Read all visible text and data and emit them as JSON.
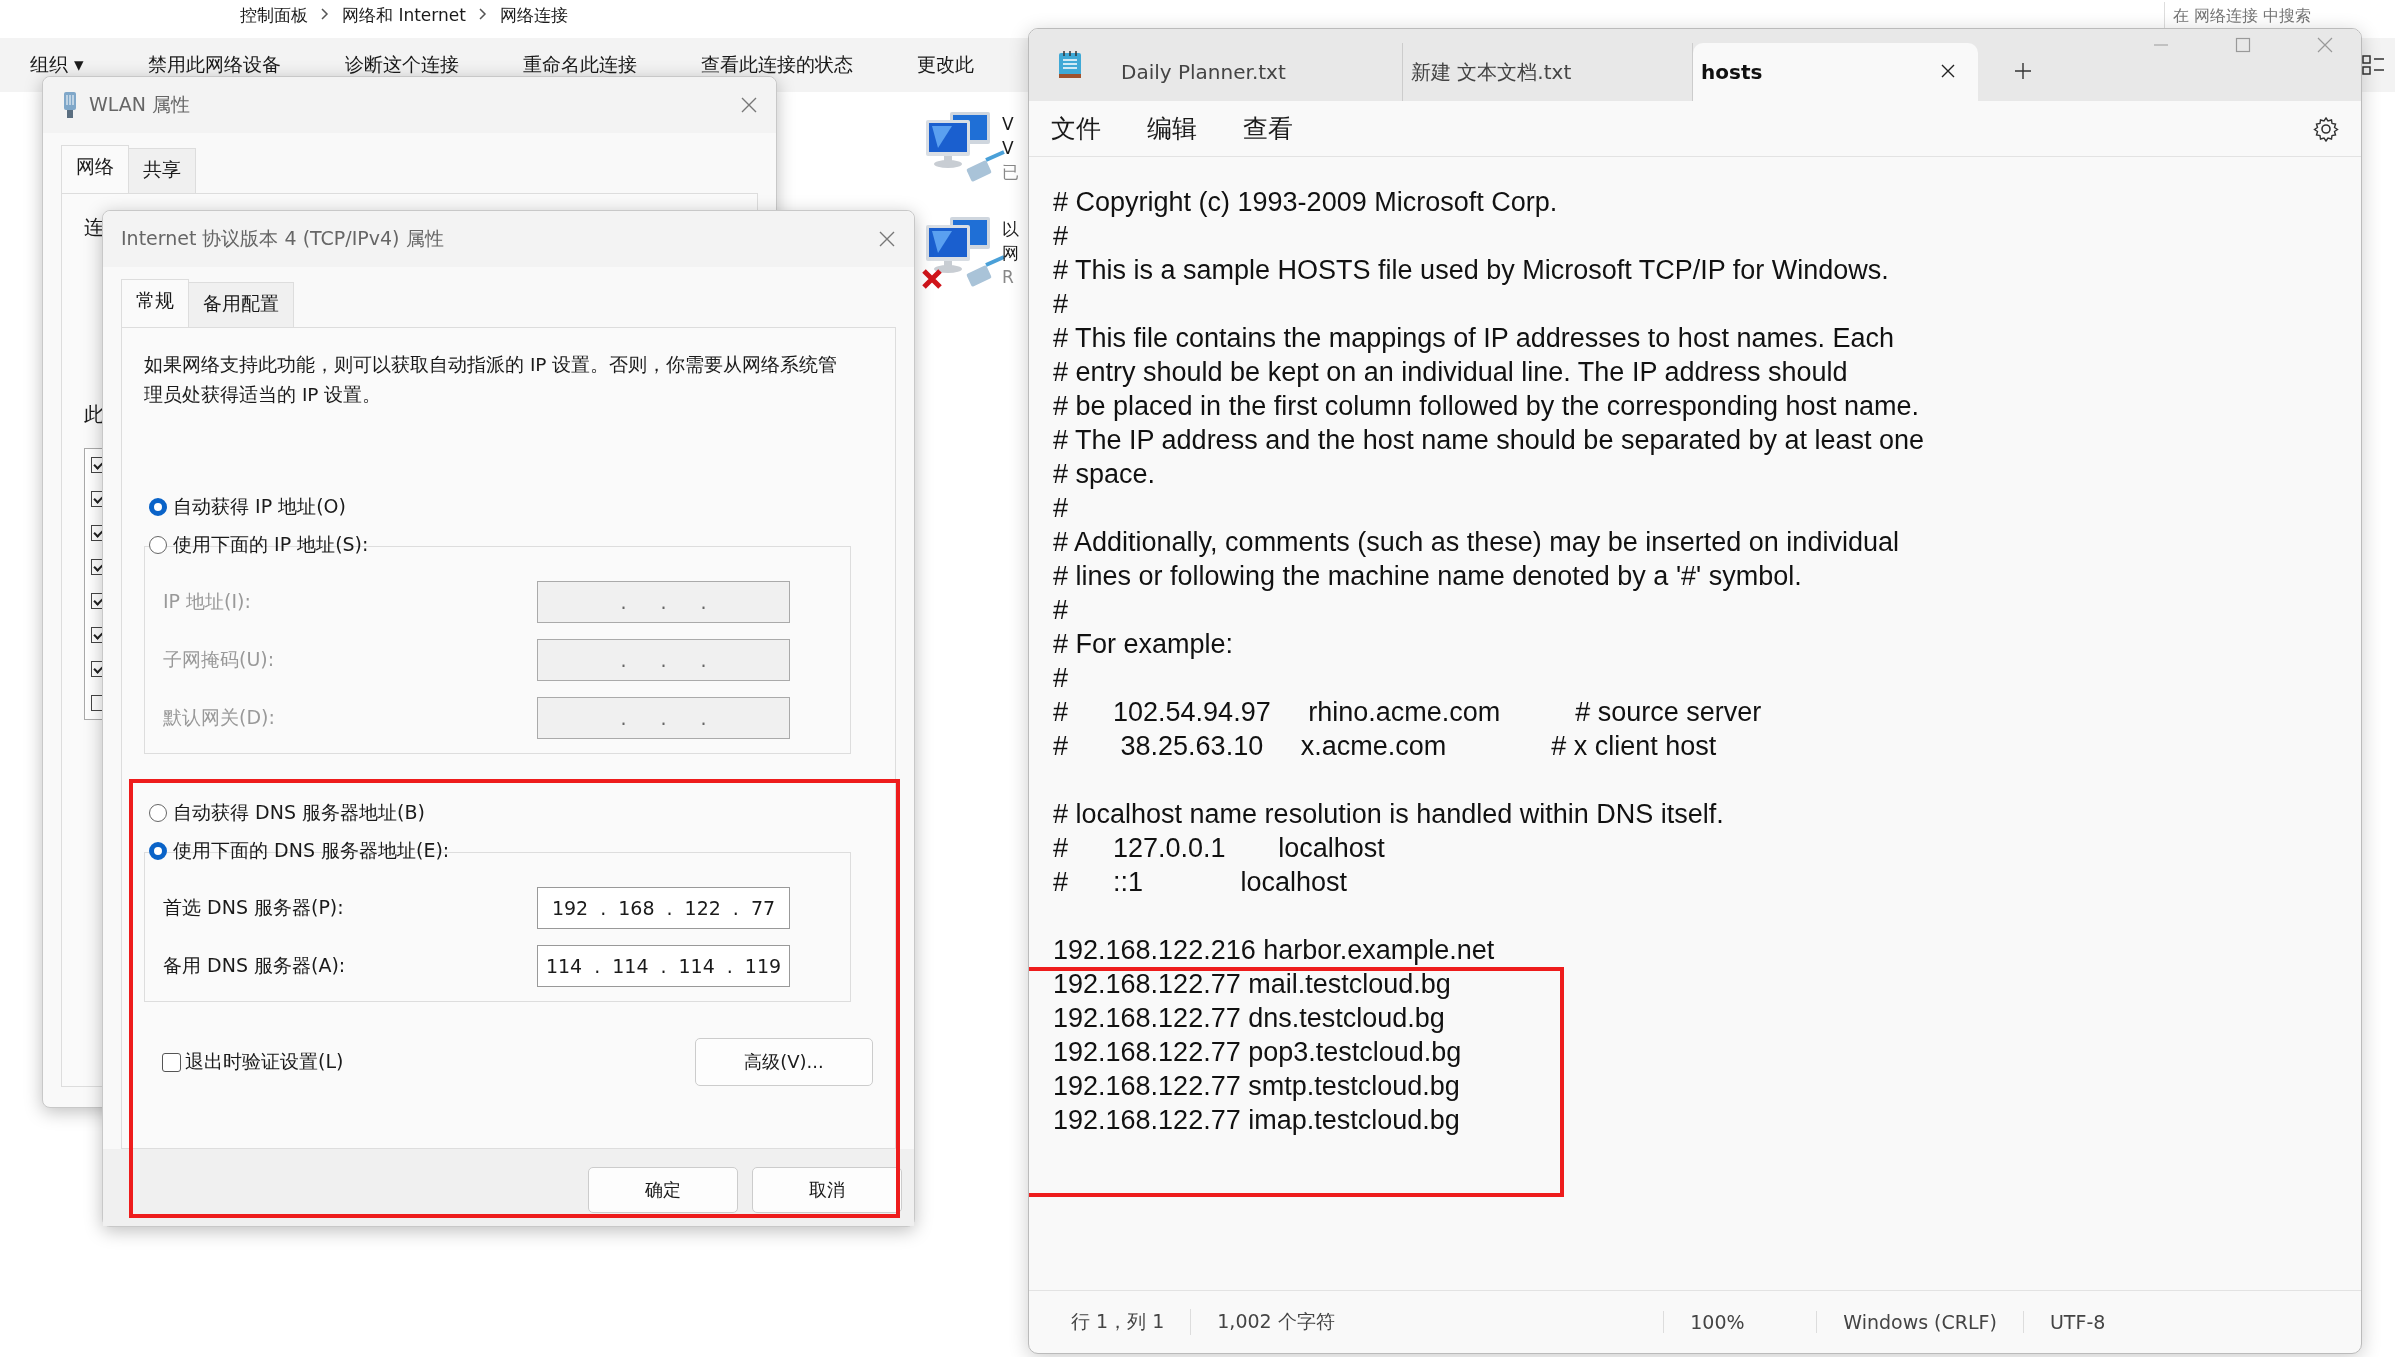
{
  "explorer": {
    "breadcrumb": [
      "控制面板",
      "网络和 Internet",
      "网络连接"
    ],
    "search": {
      "placeholder": "在 网络连接 中搜索"
    },
    "toolbar": [
      "组织 ▾",
      "禁用此网络设备",
      "诊断这个连接",
      "重命名此连接",
      "查看此连接的状态",
      "更改此"
    ],
    "connections": [
      {
        "lines": [
          "V",
          "V",
          "已"
        ],
        "disabled": false
      },
      {
        "lines": [
          "以",
          "网",
          "R"
        ],
        "disabled": true
      }
    ]
  },
  "wlan_dialog": {
    "title": "WLAN 属性",
    "tabs": [
      {
        "label": "网络",
        "selected": true
      },
      {
        "label": "共享",
        "selected": false
      }
    ],
    "fragments": [
      "连",
      "此"
    ],
    "items": [
      {
        "checked": true
      },
      {
        "checked": true
      },
      {
        "checked": true
      },
      {
        "checked": true
      },
      {
        "checked": true
      },
      {
        "checked": true
      },
      {
        "checked": true
      },
      {
        "checked": false
      }
    ]
  },
  "ipv4_dialog": {
    "title": "Internet 协议版本 4 (TCP/IPv4) 属性",
    "tabs": [
      {
        "label": "常规",
        "selected": true
      },
      {
        "label": "备用配置",
        "selected": false
      }
    ],
    "description": "如果网络支持此功能，则可以获取自动指派的 IP 设置。否则，你需要从网络系统管理员处获得适当的 IP 设置。",
    "separator": ".",
    "ip_options": [
      {
        "label": "自动获得 IP 地址(O)",
        "selected": true
      },
      {
        "label": "使用下面的 IP 地址(S):",
        "selected": false
      }
    ],
    "ip_fields": [
      {
        "label": "IP 地址(I):",
        "disabled": true
      },
      {
        "label": "子网掩码(U):",
        "disabled": true
      },
      {
        "label": "默认网关(D):",
        "disabled": true
      }
    ],
    "dns_options": [
      {
        "label": "自动获得 DNS 服务器地址(B)",
        "selected": false
      },
      {
        "label": "使用下面的 DNS 服务器地址(E):",
        "selected": true
      }
    ],
    "dns_fields": [
      {
        "label": "首选 DNS 服务器(P):",
        "octets": [
          "192",
          "168",
          "122",
          "77"
        ]
      },
      {
        "label": "备用 DNS 服务器(A):",
        "octets": [
          "114",
          "114",
          "114",
          "119"
        ]
      }
    ],
    "validate": {
      "label": "退出时验证设置(L)",
      "checked": false
    },
    "advanced_button": "高级(V)...",
    "buttons": [
      "确定",
      "取消"
    ]
  },
  "notepad": {
    "tabs": [
      {
        "title": "Daily Planner.txt",
        "selected": false
      },
      {
        "title": "新建 文本文档.txt",
        "selected": false
      },
      {
        "title": "hosts",
        "selected": true
      }
    ],
    "menu": [
      "文件",
      "编辑",
      "查看"
    ],
    "content": "# Copyright (c) 1993-2009 Microsoft Corp.\n#\n# This is a sample HOSTS file used by Microsoft TCP/IP for Windows.\n#\n# This file contains the mappings of IP addresses to host names. Each\n# entry should be kept on an individual line. The IP address should\n# be placed in the first column followed by the corresponding host name.\n# The IP address and the host name should be separated by at least one\n# space.\n#\n# Additionally, comments (such as these) may be inserted on individual\n# lines or following the machine name denoted by a '#' symbol.\n#\n# For example:\n#\n#      102.54.94.97     rhino.acme.com          # source server\n#       38.25.63.10     x.acme.com              # x client host\n\n# localhost name resolution is handled within DNS itself.\n#      127.0.0.1       localhost\n#      ::1             localhost\n\n192.168.122.216 harbor.example.net\n192.168.122.77 mail.testcloud.bg\n192.168.122.77 dns.testcloud.bg\n192.168.122.77 pop3.testcloud.bg\n192.168.122.77 smtp.testcloud.bg\n192.168.122.77 imap.testcloud.bg",
    "status_bar": [
      "行 1，列 1",
      "1,002 个字符",
      "100%",
      "Windows (CRLF)",
      "UTF-8"
    ]
  }
}
